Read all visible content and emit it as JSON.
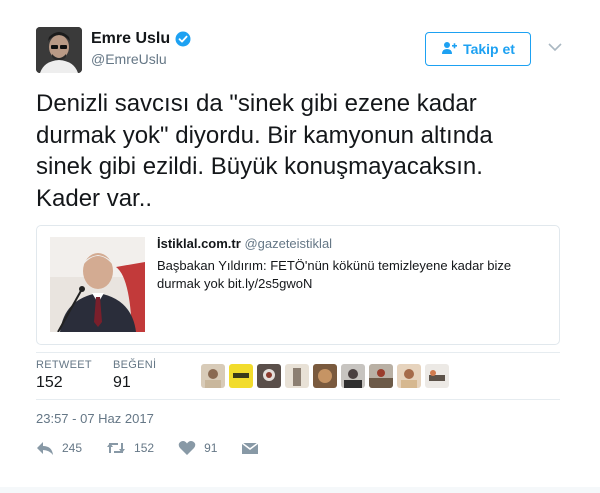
{
  "author": {
    "name": "Emre Uslu",
    "handle": "@EmreUslu"
  },
  "follow_label": "Takip et",
  "tweet_text": "Denizli savcısı da \"sinek gibi ezene kadar\ndurmak yok\" diyordu. Bir kamyonun altında\nsinek gibi ezildi. Büyük konuşmayacaksın.\nKader var..",
  "quote": {
    "name": "İstiklal.com.tr",
    "handle": "@gazeteistiklal",
    "text": "Başbakan Yıldırım: FETÖ'nün kökünü temizleyene kadar bize durmak yok bit.ly/2s5gwoN"
  },
  "stats": {
    "retweet_label": "RETWEET",
    "retweet_count": "152",
    "like_label": "BEĞENİ",
    "like_count": "91"
  },
  "timestamp": "23:57 - 07 Haz 2017",
  "actions": {
    "reply_count": "245",
    "retweet_count": "152",
    "like_count": "91"
  },
  "colors": {
    "accent": "#1da1f2",
    "secondary_text": "#657786",
    "border": "#e1e8ed"
  },
  "icons": [
    "verified-icon",
    "follow-person-icon",
    "chevron-down-icon",
    "reply-icon",
    "retweet-icon",
    "heart-icon",
    "message-icon"
  ]
}
